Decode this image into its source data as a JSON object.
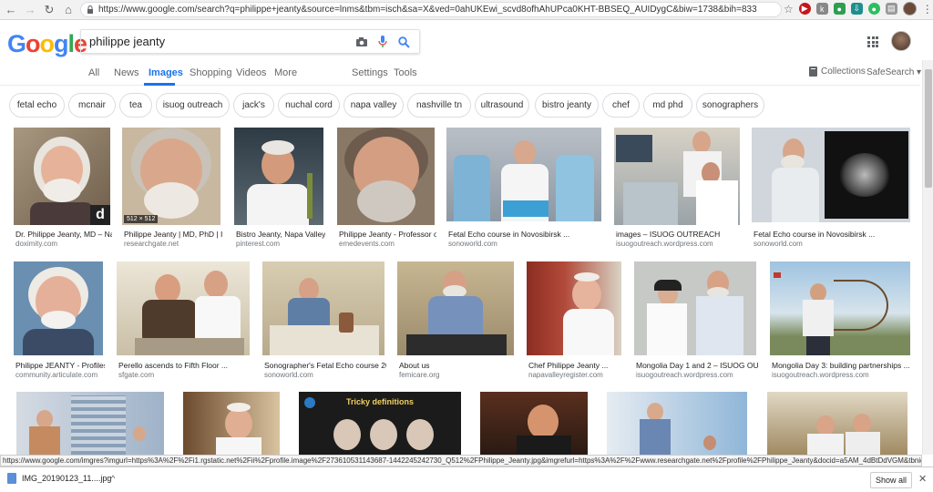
{
  "browser": {
    "url": "https://www.google.com/search?q=philippe+jeanty&source=lnms&tbm=isch&sa=X&ved=0ahUKEwi_scvd8ofhAhUPca0KHT-BBSEQ_AUIDygC&biw=1738&bih=833"
  },
  "google": {
    "logo": [
      "G",
      "o",
      "o",
      "g",
      "l",
      "e"
    ],
    "logo_colors": [
      "#4285f4",
      "#ea4335",
      "#fbbc05",
      "#4285f4",
      "#34a853",
      "#ea4335"
    ],
    "query": "philippe jeanty"
  },
  "tabs": {
    "all": "All",
    "news": "News",
    "images": "Images",
    "shopping": "Shopping",
    "videos": "Videos",
    "more": "More",
    "settings": "Settings",
    "tools": "Tools",
    "collections": "Collections",
    "safesearch": "SafeSearch ▾"
  },
  "chips": [
    "fetal echo",
    "mcnair",
    "tea",
    "isuog outreach",
    "jack's",
    "nuchal cord",
    "napa valley",
    "nashville tn",
    "ultrasound",
    "bistro jeanty",
    "chef",
    "md phd",
    "sonographers"
  ],
  "results": [
    {
      "title": "Dr. Philippe Jeanty, MD – Nas...",
      "source": "doximity.com"
    },
    {
      "title": "Philippe Jeanty | MD, PhD | In...",
      "source": "researchgate.net",
      "badge": "512 × 512"
    },
    {
      "title": "Bistro Jeanty, Napa Valley ...",
      "source": "pinterest.com"
    },
    {
      "title": "Philippe Jeanty - Professor of...",
      "source": "emedevents.com"
    },
    {
      "title": "Fetal Echo course in Novosibirsk ...",
      "source": "sonoworld.com"
    },
    {
      "title": "images – ISUOG OUTREACH",
      "source": "isuogoutreach.wordpress.com"
    },
    {
      "title": "Fetal Echo course in Novosibirsk ...",
      "source": "sonoworld.com"
    },
    {
      "title": "Philippe JEANTY - Profiles -...",
      "source": "community.articulate.com"
    },
    {
      "title": "Perello ascends to Fifth Floor ...",
      "source": "sfgate.com"
    },
    {
      "title": "Sonographer's Fetal Echo course 200...",
      "source": "sonoworld.com"
    },
    {
      "title": "About us",
      "source": "femicare.org"
    },
    {
      "title": "Chef Philippe Jeanty ...",
      "source": "napavalleyregister.com"
    },
    {
      "title": "Mongolia Day 1 and 2 – ISUOG OUTRE...",
      "source": "isuogoutreach.wordpress.com"
    },
    {
      "title": "Mongolia Day 3: building partnerships ...",
      "source": "isuogoutreach.wordpress.com"
    }
  ],
  "third_row_text": {
    "tricky_title": "Tricky definitions"
  },
  "status_url": "https://www.google.com/imgres?imgurl=https%3A%2F%2Fi1.rgstatic.net%2Fii%2Fprofile.image%2F273610531143687-1442245242730_Q512%2FPhilippe_Jeanty.jpg&imgrefurl=https%3A%2F%2Fwww.researchgate.net%2Fprofile%2FPhilippe_Jeanty&docid=a5AM_4dBtDdVGM&tbnid=tAx1AcC8gOyAXM%3A&vet=10ahUK...",
  "download": {
    "file": "IMG_20190123_11....jpg",
    "show_all": "Show all"
  },
  "badge_d": "d"
}
